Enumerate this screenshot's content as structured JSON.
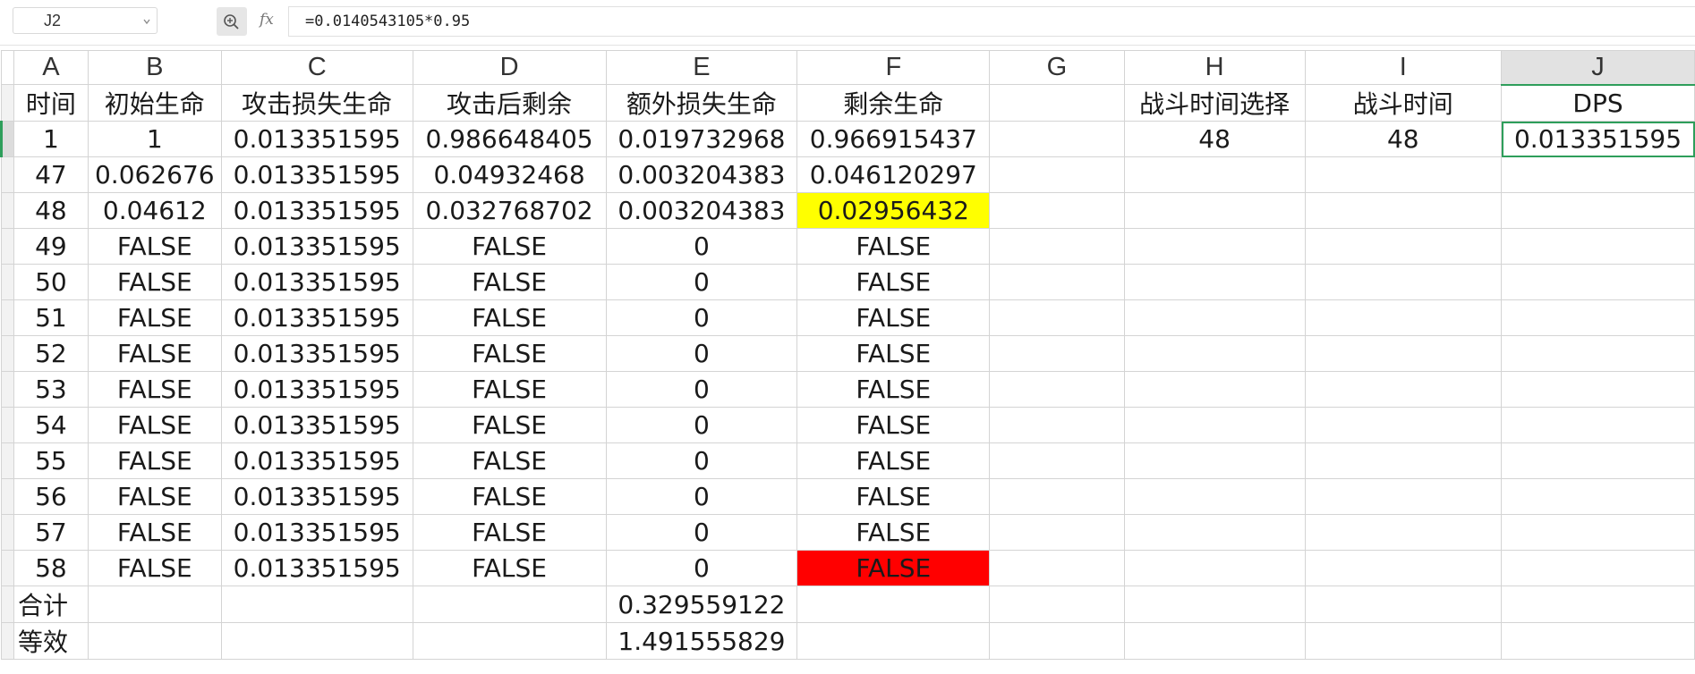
{
  "formula_bar": {
    "cell_ref": "J2",
    "fx_label": "fx",
    "formula": "=0.0140543105*0.95"
  },
  "icons": {
    "zoom": "zoom-in-icon",
    "dropdown": "chevron-down-icon"
  },
  "colors": {
    "highlight_yellow": "#ffff00",
    "highlight_red": "#ff0000",
    "selection": "#2e9e5b"
  },
  "sheet": {
    "active_cell": "J2",
    "column_headers": [
      "A",
      "B",
      "C",
      "D",
      "E",
      "F",
      "G",
      "H",
      "I",
      "J"
    ],
    "rows": [
      [
        "时间",
        "初始生命",
        "攻击损失生命",
        "攻击后剩余",
        "额外损失生命",
        "剩余生命",
        "",
        "战斗时间选择",
        "战斗时间",
        "DPS"
      ],
      [
        "1",
        "1",
        "0.013351595",
        "0.986648405",
        "0.019732968",
        "0.966915437",
        "",
        "48",
        "48",
        "0.013351595"
      ],
      [
        "47",
        "0.062676",
        "0.013351595",
        "0.04932468",
        "0.003204383",
        "0.046120297",
        "",
        "",
        "",
        ""
      ],
      [
        "48",
        "0.04612",
        "0.013351595",
        "0.032768702",
        "0.003204383",
        "0.02956432",
        "",
        "",
        "",
        ""
      ],
      [
        "49",
        "FALSE",
        "0.013351595",
        "FALSE",
        "0",
        "FALSE",
        "",
        "",
        "",
        ""
      ],
      [
        "50",
        "FALSE",
        "0.013351595",
        "FALSE",
        "0",
        "FALSE",
        "",
        "",
        "",
        ""
      ],
      [
        "51",
        "FALSE",
        "0.013351595",
        "FALSE",
        "0",
        "FALSE",
        "",
        "",
        "",
        ""
      ],
      [
        "52",
        "FALSE",
        "0.013351595",
        "FALSE",
        "0",
        "FALSE",
        "",
        "",
        "",
        ""
      ],
      [
        "53",
        "FALSE",
        "0.013351595",
        "FALSE",
        "0",
        "FALSE",
        "",
        "",
        "",
        ""
      ],
      [
        "54",
        "FALSE",
        "0.013351595",
        "FALSE",
        "0",
        "FALSE",
        "",
        "",
        "",
        ""
      ],
      [
        "55",
        "FALSE",
        "0.013351595",
        "FALSE",
        "0",
        "FALSE",
        "",
        "",
        "",
        ""
      ],
      [
        "56",
        "FALSE",
        "0.013351595",
        "FALSE",
        "0",
        "FALSE",
        "",
        "",
        "",
        ""
      ],
      [
        "57",
        "FALSE",
        "0.013351595",
        "FALSE",
        "0",
        "FALSE",
        "",
        "",
        "",
        ""
      ],
      [
        "58",
        "FALSE",
        "0.013351595",
        "FALSE",
        "0",
        "FALSE",
        "",
        "",
        "",
        ""
      ],
      [
        "合计",
        "",
        "",
        "",
        "0.329559122",
        "",
        "",
        "",
        "",
        ""
      ],
      [
        "等效",
        "",
        "",
        "",
        "1.491555829",
        "",
        "",
        "",
        "",
        ""
      ]
    ]
  }
}
